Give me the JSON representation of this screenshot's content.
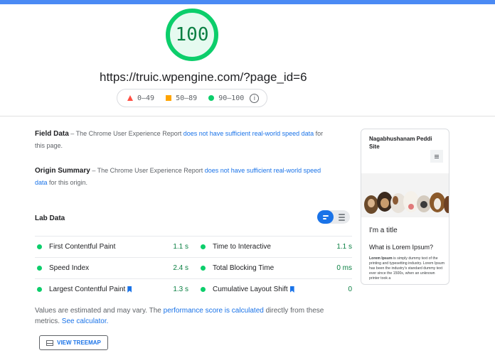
{
  "score": "100",
  "url": "https://truic.wpengine.com/?page_id=6",
  "legend": {
    "fail": "0–49",
    "average": "50–89",
    "pass": "90–100",
    "info_icon": "i"
  },
  "field_data": {
    "title": "Field Data",
    "text_pre": " – The Chrome User Experience Report ",
    "link": "does not have sufficient real-world speed data",
    "text_post": " for this page."
  },
  "origin_summary": {
    "title": "Origin Summary",
    "text_pre": " – The Chrome User Experience Report ",
    "link": "does not have sufficient real-world speed data",
    "text_post": " for this origin."
  },
  "lab_data": {
    "title": "Lab Data",
    "metrics": [
      {
        "label": "First Contentful Paint",
        "value": "1.1 s"
      },
      {
        "label": "Time to Interactive",
        "value": "1.1 s"
      },
      {
        "label": "Speed Index",
        "value": "2.4 s"
      },
      {
        "label": "Total Blocking Time",
        "value": "0 ms"
      },
      {
        "label": "Largest Contentful Paint",
        "value": "1.3 s"
      },
      {
        "label": "Cumulative Layout Shift",
        "value": "0"
      }
    ]
  },
  "note": {
    "pre": "Values are estimated and may vary. The ",
    "link1": "performance score is calculated",
    "mid": " directly from these metrics. ",
    "link2": "See calculator."
  },
  "treemap_button": "VIEW TREEMAP",
  "preview": {
    "site_name": "Nagabhushanam Peddi Site",
    "title": "I'm a title",
    "subtitle": "What is Lorem Ipsum?",
    "lead": "Lorem Ipsum",
    "body": " is simply dummy text of the printing and typesetting industry. Lorem Ipsum has been the industry's standard dummy text ever since the 1500s, when an unknown printer took a"
  },
  "colors": {
    "pass": "#0cce6b",
    "average": "#ffa400",
    "fail": "#ff4e42",
    "accent": "#1a73e8"
  }
}
